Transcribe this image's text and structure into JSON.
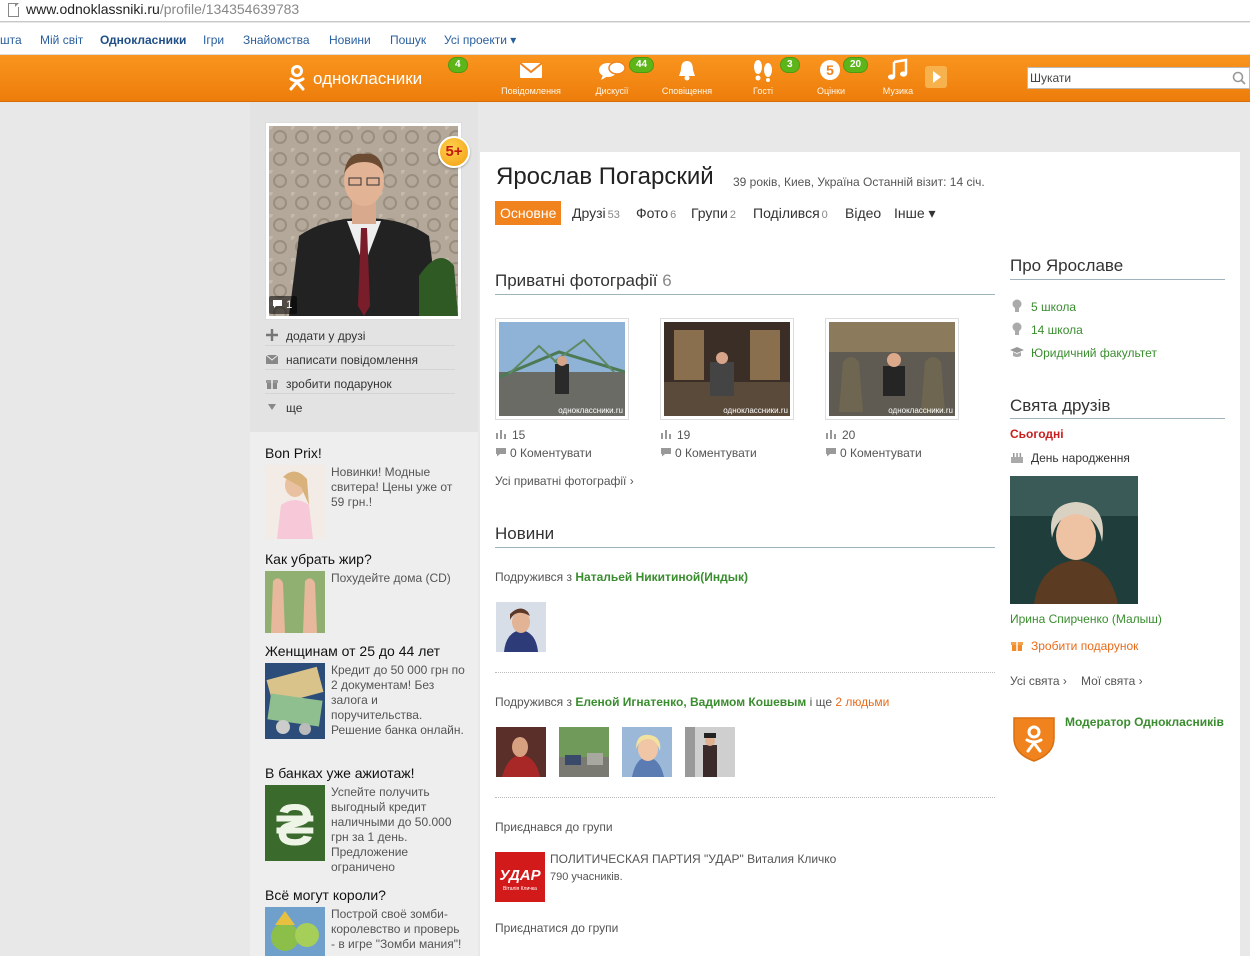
{
  "browser": {
    "url_domain": "www.odnoklassniki.ru",
    "url_path": "/profile/134354639783"
  },
  "projects_bar": {
    "items": [
      "шта",
      "Мій світ",
      "Однокласники",
      "Ігри",
      "Знайомства",
      "Новини",
      "Пошук",
      "Усі проекти ▾"
    ]
  },
  "toolbar": {
    "logo_text": "однокласники",
    "logo_badge": "4",
    "items": [
      {
        "label": "Повідомлення",
        "icon": "envelope-icon",
        "badge": ""
      },
      {
        "label": "Дискусії",
        "icon": "discussions-icon",
        "badge": "44"
      },
      {
        "label": "Сповіщення",
        "icon": "bell-icon",
        "badge": ""
      },
      {
        "label": "Гості",
        "icon": "footprints-icon",
        "badge": "3"
      },
      {
        "label": "Оцінки",
        "icon": "rating-icon",
        "badge": "20"
      },
      {
        "label": "Музика",
        "icon": "music-note-icon",
        "badge": ""
      }
    ],
    "search_placeholder": "Шукати"
  },
  "profile": {
    "avatar_badge": "5+",
    "comment_count": "1",
    "actions": [
      "додати у друзі",
      "написати повідомлення",
      "зробити подарунок",
      "ще"
    ],
    "name": "Ярослав Погарский",
    "meta": "39 років, Киев, Україна  Останній візит: 14 січ.",
    "tabs": [
      {
        "label": "Основне",
        "count": ""
      },
      {
        "label": "Друзі",
        "count": "53"
      },
      {
        "label": "Фото",
        "count": "6"
      },
      {
        "label": "Групи",
        "count": "2"
      },
      {
        "label": "Поділився",
        "count": "0"
      },
      {
        "label": "Відео",
        "count": ""
      },
      {
        "label": "Інше ▾",
        "count": ""
      }
    ]
  },
  "ads": [
    {
      "title": "Bon Prix!",
      "text": "Новинки! Модные свитера! Цены уже от 59 грн.!"
    },
    {
      "title": "Как убрать жир?",
      "text": "Похудейте дома (CD)"
    },
    {
      "title": "Женщинам от 25 до 44 лет",
      "text": "Кредит до 50 000 грн по 2 документам! Без залога и поручительства. Решение банка онлайн."
    },
    {
      "title": "В банках уже ажиотаж!",
      "text": "Успейте получить выгодный кредит наличными до 50.000 грн за 1 день. Предложение ограничено"
    },
    {
      "title": "Всё могут короли?",
      "text": "Построй своё зомби-королевство и проверь - в игре \"Зомби мания\"!"
    }
  ],
  "private_photos": {
    "title": "Приватні фотографії",
    "count": "6",
    "photos": [
      {
        "views": "15",
        "comments": "0 Коментувати"
      },
      {
        "views": "19",
        "comments": "0 Коментувати"
      },
      {
        "views": "20",
        "comments": "0 Коментувати"
      }
    ],
    "all_link": "Усі приватні фотографії ›"
  },
  "news": {
    "title": "Новини",
    "item1_prefix": "Подружився з ",
    "item1_name": "Натальей Никитиной(Индык)",
    "item2_prefix": "Подружився з ",
    "item2_names": "Еленой Игнатенко, Вадимом Кошевым",
    "item2_mid": " і ще ",
    "item2_more": "2 людьми",
    "item3_text": "Приєднався до групи",
    "group_name": "ПОЛИТИЧЕСКАЯ ПАРТИЯ \"УДАР\" Виталия Кличко",
    "group_members": "790 учасників.",
    "group_logo": "УДАР",
    "group_logo_sub": "Віталія Кличка",
    "join_link": "Приєднатися до групи"
  },
  "about": {
    "title": "Про Ярославе",
    "items": [
      "5 школа",
      "14 школа",
      "Юридичний факультет"
    ]
  },
  "holidays": {
    "title": "Свята друзів",
    "today": "Сьогодні",
    "event": "День народження",
    "person": "Ирина Спирченко (Малыш)",
    "gift": "Зробити подарунок",
    "all_link": "Усі свята ›",
    "my_link": "Мої свята ›"
  },
  "moderator": {
    "label": "Модератор Однокласників"
  },
  "watermark": "одноклассники.ru",
  "colors": {
    "toolbar_orange": "#f0831e",
    "link_green": "#3a8d2f",
    "badge_green": "#5db51a"
  }
}
